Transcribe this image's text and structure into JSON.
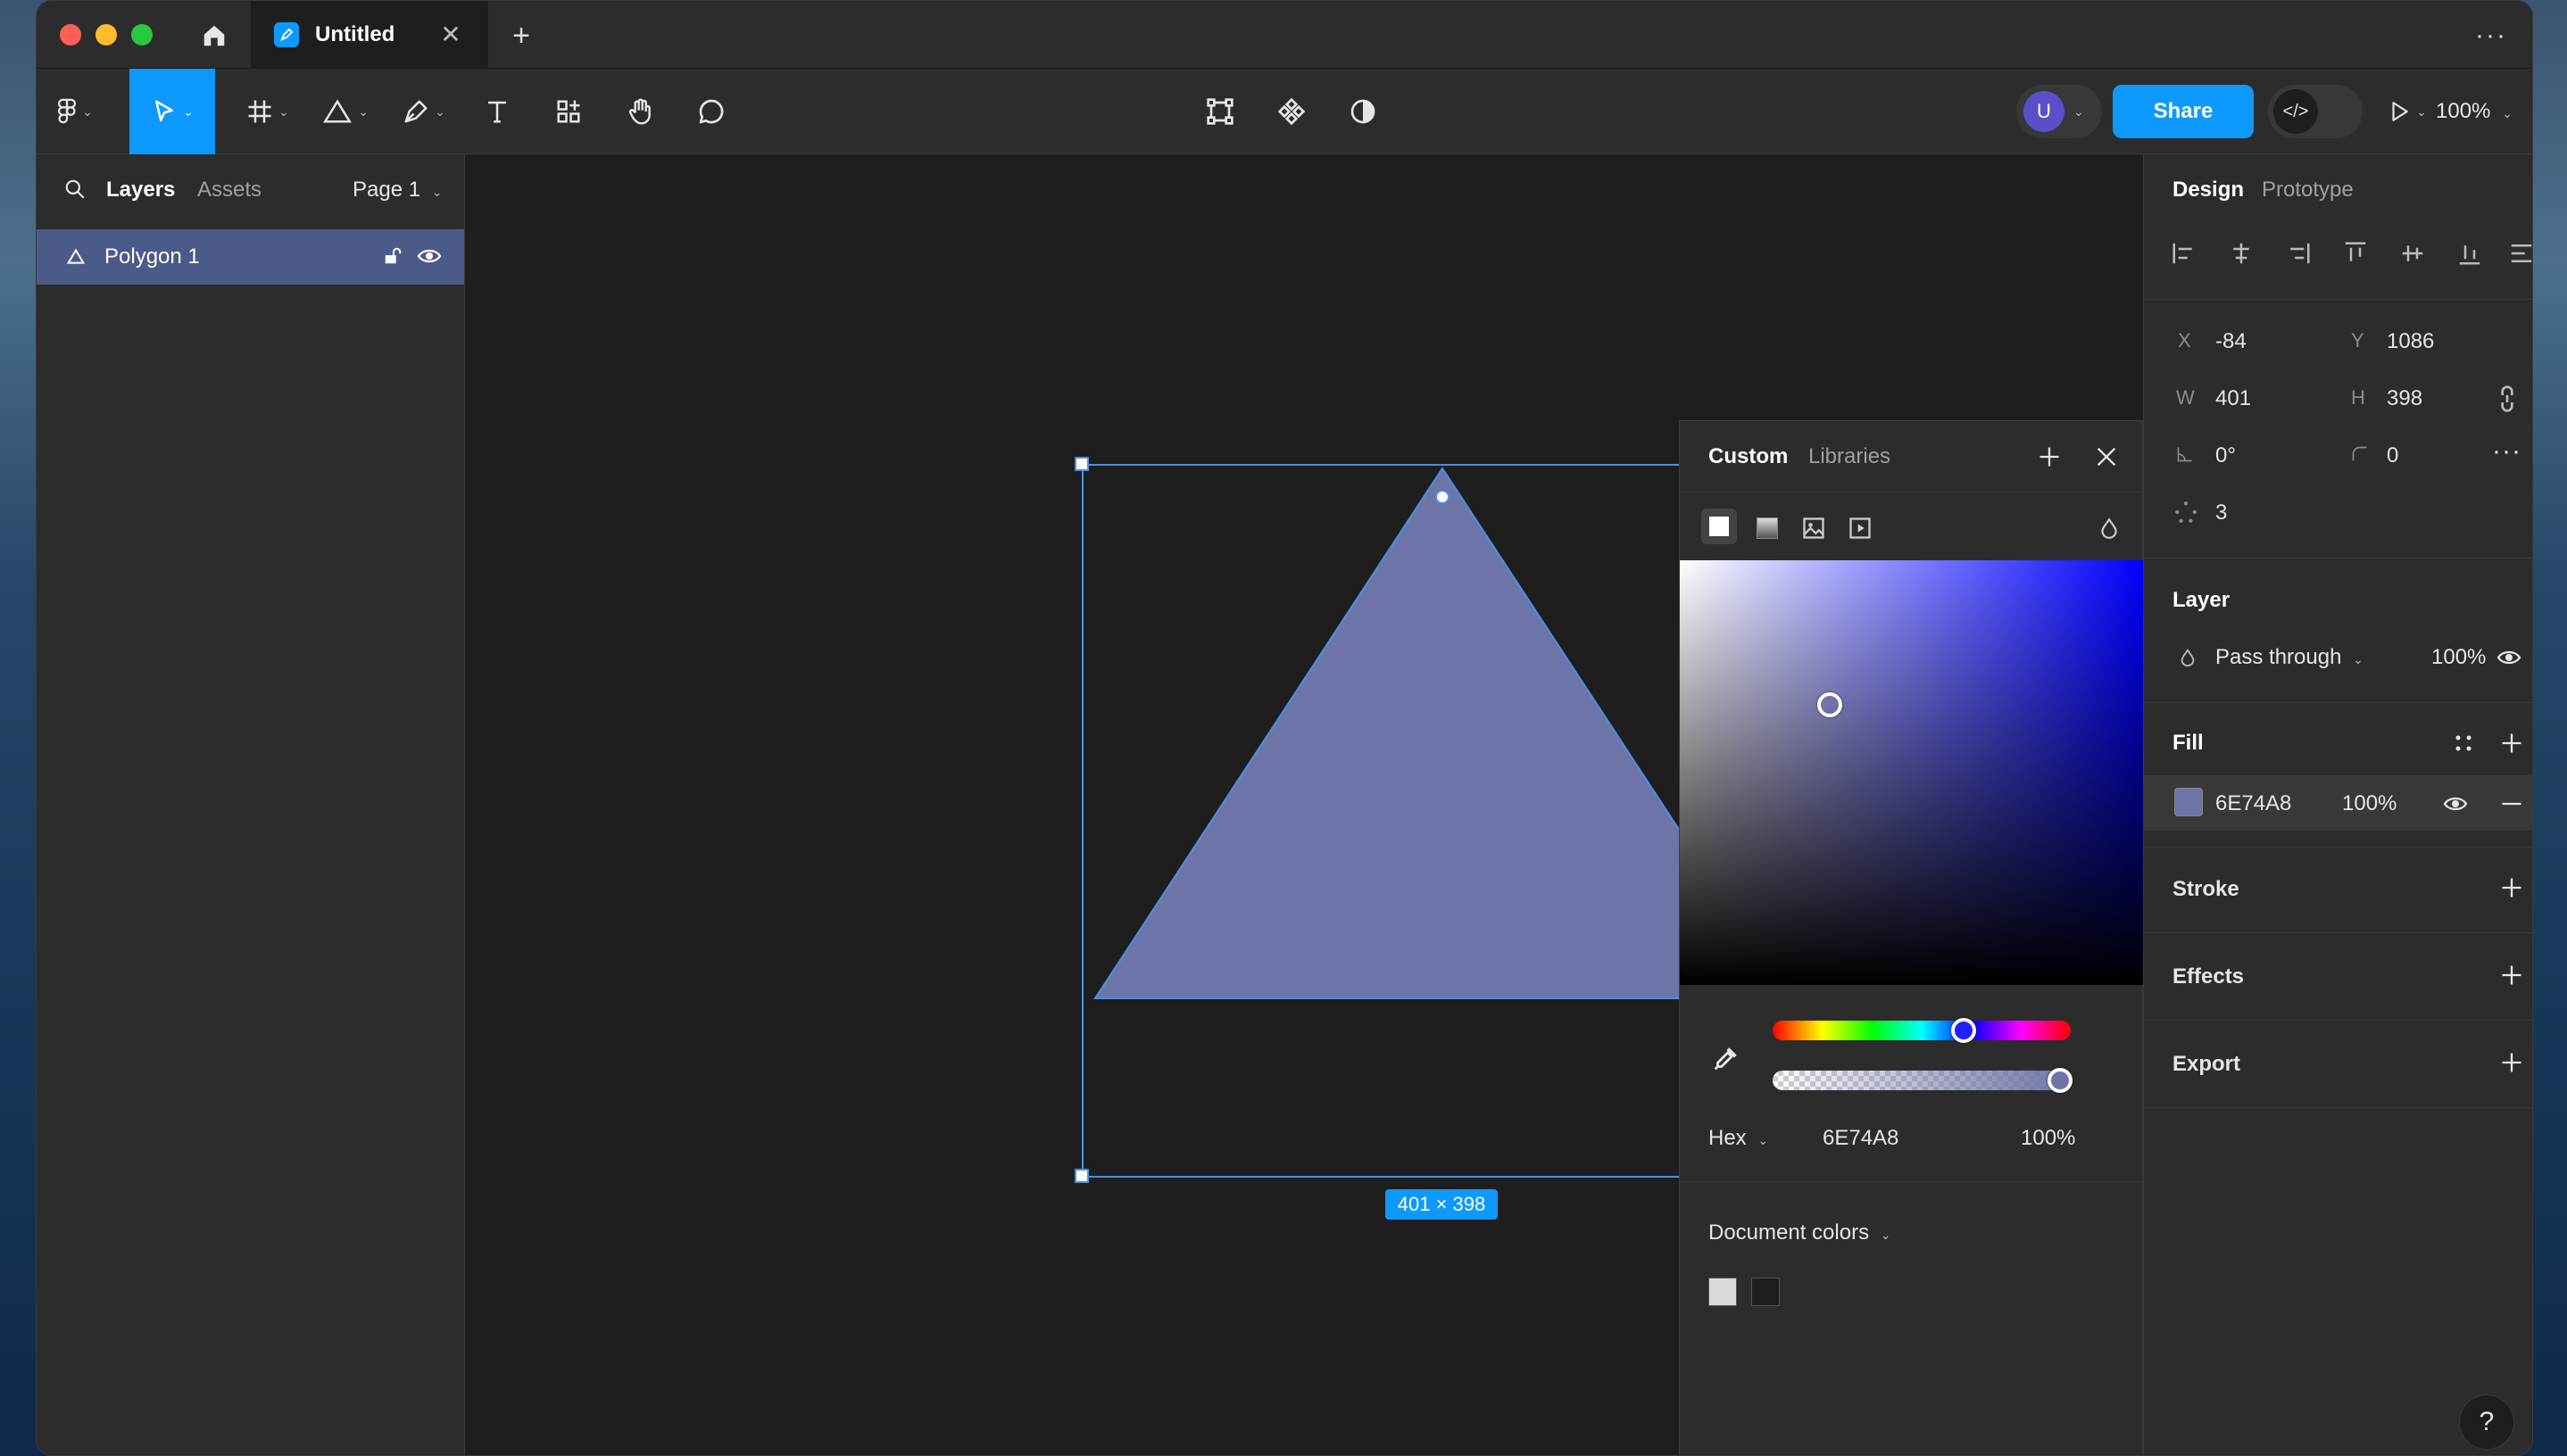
{
  "titlebar": {
    "tab_title": "Untitled",
    "close_glyph": "✕",
    "new_tab_glyph": "+",
    "more_glyph": "···"
  },
  "toolbar": {
    "avatar_initial": "U",
    "share_label": "Share",
    "dev_mode_glyph": "</>",
    "zoom_label": "100%"
  },
  "left_panel": {
    "tabs": [
      "Layers",
      "Assets"
    ],
    "page_label": "Page 1",
    "layers": [
      {
        "name": "Polygon 1"
      }
    ]
  },
  "canvas": {
    "size_badge": "401 × 398",
    "fill_color": "#6E74A8",
    "selection_color": "#4a90e2"
  },
  "color_picker": {
    "tabs": [
      "Custom",
      "Libraries"
    ],
    "format_label": "Hex",
    "hex_value": "6E74A8",
    "opacity_value": "100%",
    "document_colors_label": "Document colors",
    "document_colors": [
      "#d9d9d9",
      "#1e1e1e"
    ]
  },
  "right_panel": {
    "tabs": [
      "Design",
      "Prototype"
    ],
    "props": {
      "x_label": "X",
      "x_value": "-84",
      "y_label": "Y",
      "y_value": "1086",
      "w_label": "W",
      "w_value": "401",
      "h_label": "H",
      "h_value": "398",
      "rotation_value": "0°",
      "radius_value": "0",
      "count_value": "3"
    },
    "layer": {
      "title": "Layer",
      "blend_mode": "Pass through",
      "opacity": "100%"
    },
    "fill": {
      "title": "Fill",
      "hex": "6E74A8",
      "opacity": "100%",
      "swatch": "#6E74A8"
    },
    "stroke_title": "Stroke",
    "effects_title": "Effects",
    "export_title": "Export"
  },
  "help_label": "?",
  "colors": {
    "accent": "#0d99ff",
    "panel": "#2c2c2c",
    "canvas": "#1e1e1e",
    "layer_selected": "#4c5a8a"
  }
}
